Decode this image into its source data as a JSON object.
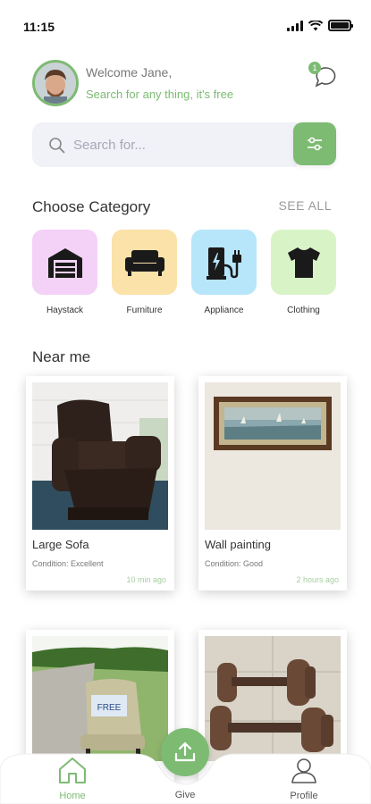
{
  "status_bar": {
    "time": "11:15"
  },
  "header": {
    "greeting": "Welcome Jane,",
    "subtitle": "Search for any thing, it's free",
    "chat_badge": "1"
  },
  "search": {
    "placeholder": "Search for..."
  },
  "categories_section": {
    "title": "Choose Category",
    "see_all": "SEE ALL",
    "items": [
      {
        "label": "Haystack",
        "icon": "garage-icon",
        "color": "#f4d2f7"
      },
      {
        "label": "Furniture",
        "icon": "sofa-icon",
        "color": "#fbe2a9"
      },
      {
        "label": "Appliance",
        "icon": "ev-charger-icon",
        "color": "#b7e6fb"
      },
      {
        "label": "Clothing",
        "icon": "tshirt-icon",
        "color": "#d8f4c7"
      }
    ]
  },
  "near_me": {
    "title": "Near me",
    "items": [
      {
        "name": "Large Sofa",
        "condition": "Condition: Excellent",
        "time": "10 min ago"
      },
      {
        "name": "Wall painting",
        "condition": "Condition: Good",
        "time": "2 hours ago"
      },
      {
        "name": "",
        "condition": "",
        "time": ""
      },
      {
        "name": "",
        "condition": "",
        "time": ""
      }
    ]
  },
  "bottom_nav": {
    "home": "Home",
    "give": "Give",
    "profile": "Profile"
  },
  "colors": {
    "accent": "#7dbb73",
    "accent_light": "#a6cfa0",
    "search_bg": "#f1f1f8"
  }
}
